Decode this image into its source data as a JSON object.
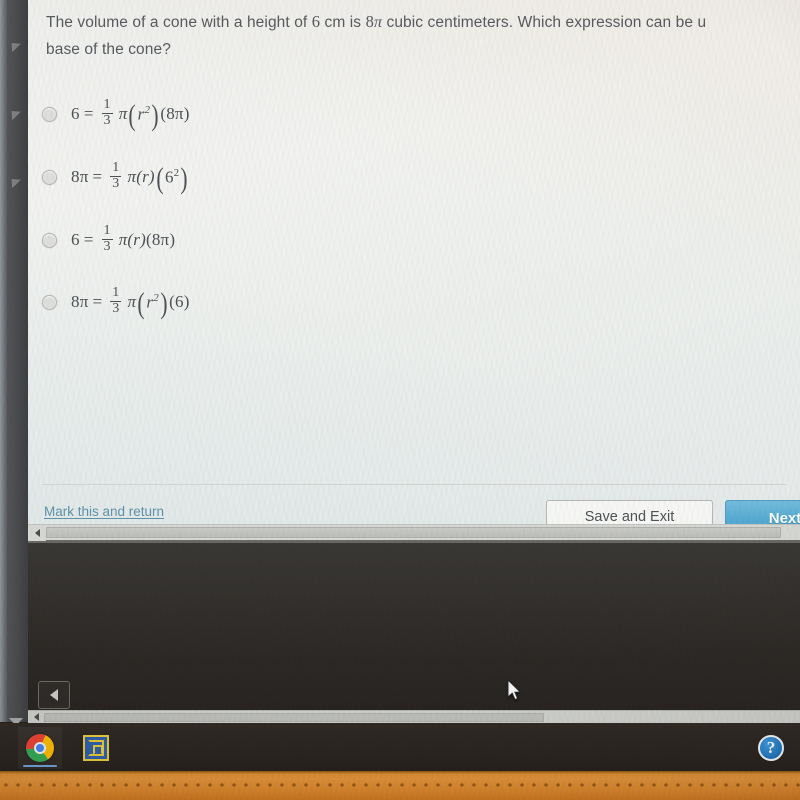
{
  "question": {
    "line1_pre": "The volume of a cone with a height of ",
    "h_value": "6",
    "line1_mid": " cm is ",
    "volume_value": "8",
    "volume_pi": "π",
    "line1_post": " cubic centimeters. Which expression can be u",
    "line2": "base of the cone?",
    "full_text": "The volume of a cone with a height of 6 cm is 8π cubic centimeters. Which expression can be u base of the cone?"
  },
  "options": [
    {
      "id": "option-a",
      "selected": false,
      "lhs": "6",
      "eq": "=",
      "frac_num": "1",
      "frac_den": "3",
      "pi": "π",
      "group1": "r²",
      "group2": "(8π)",
      "text": "6 = 1/3 π(r²)(8π)"
    },
    {
      "id": "option-b",
      "selected": false,
      "lhs": "8π",
      "eq": "=",
      "frac_num": "1",
      "frac_den": "3",
      "pi": "π",
      "group1": "(r)",
      "group2": "(6²)",
      "text": "8π = 1/3 π(r)(6²)"
    },
    {
      "id": "option-c",
      "selected": false,
      "lhs": "6",
      "eq": "=",
      "frac_num": "1",
      "frac_den": "3",
      "pi": "π",
      "group1": "(r)",
      "group2": "(8π)",
      "text": "6 = 1/3 π(r)(8π)"
    },
    {
      "id": "option-d",
      "selected": false,
      "lhs": "8π",
      "eq": "=",
      "frac_num": "1",
      "frac_den": "3",
      "pi": "π",
      "group1": "r²",
      "group2": "(6)",
      "text": "8π = 1/3 π(r²)(6)"
    }
  ],
  "footer": {
    "mark_link": "Mark this and return",
    "save_exit": "Save and Exit",
    "next": "Next"
  },
  "taskbar": {
    "items": [
      {
        "name": "chrome-icon",
        "label": "Google Chrome"
      },
      {
        "name": "maze-app-icon",
        "label": "App"
      }
    ],
    "help_glyph": "?"
  },
  "scrollbars": {
    "inner_left_caret": "◂",
    "outer_left_caret": "◂",
    "back_caret": "◂"
  },
  "colors": {
    "next_button": "#57abd2",
    "link": "#5f92a8",
    "panel_bg": "#eeeeec",
    "desk_orange": "#d98a2a",
    "taskbar": "#2a2420",
    "help_blue": "#1f72bd"
  }
}
